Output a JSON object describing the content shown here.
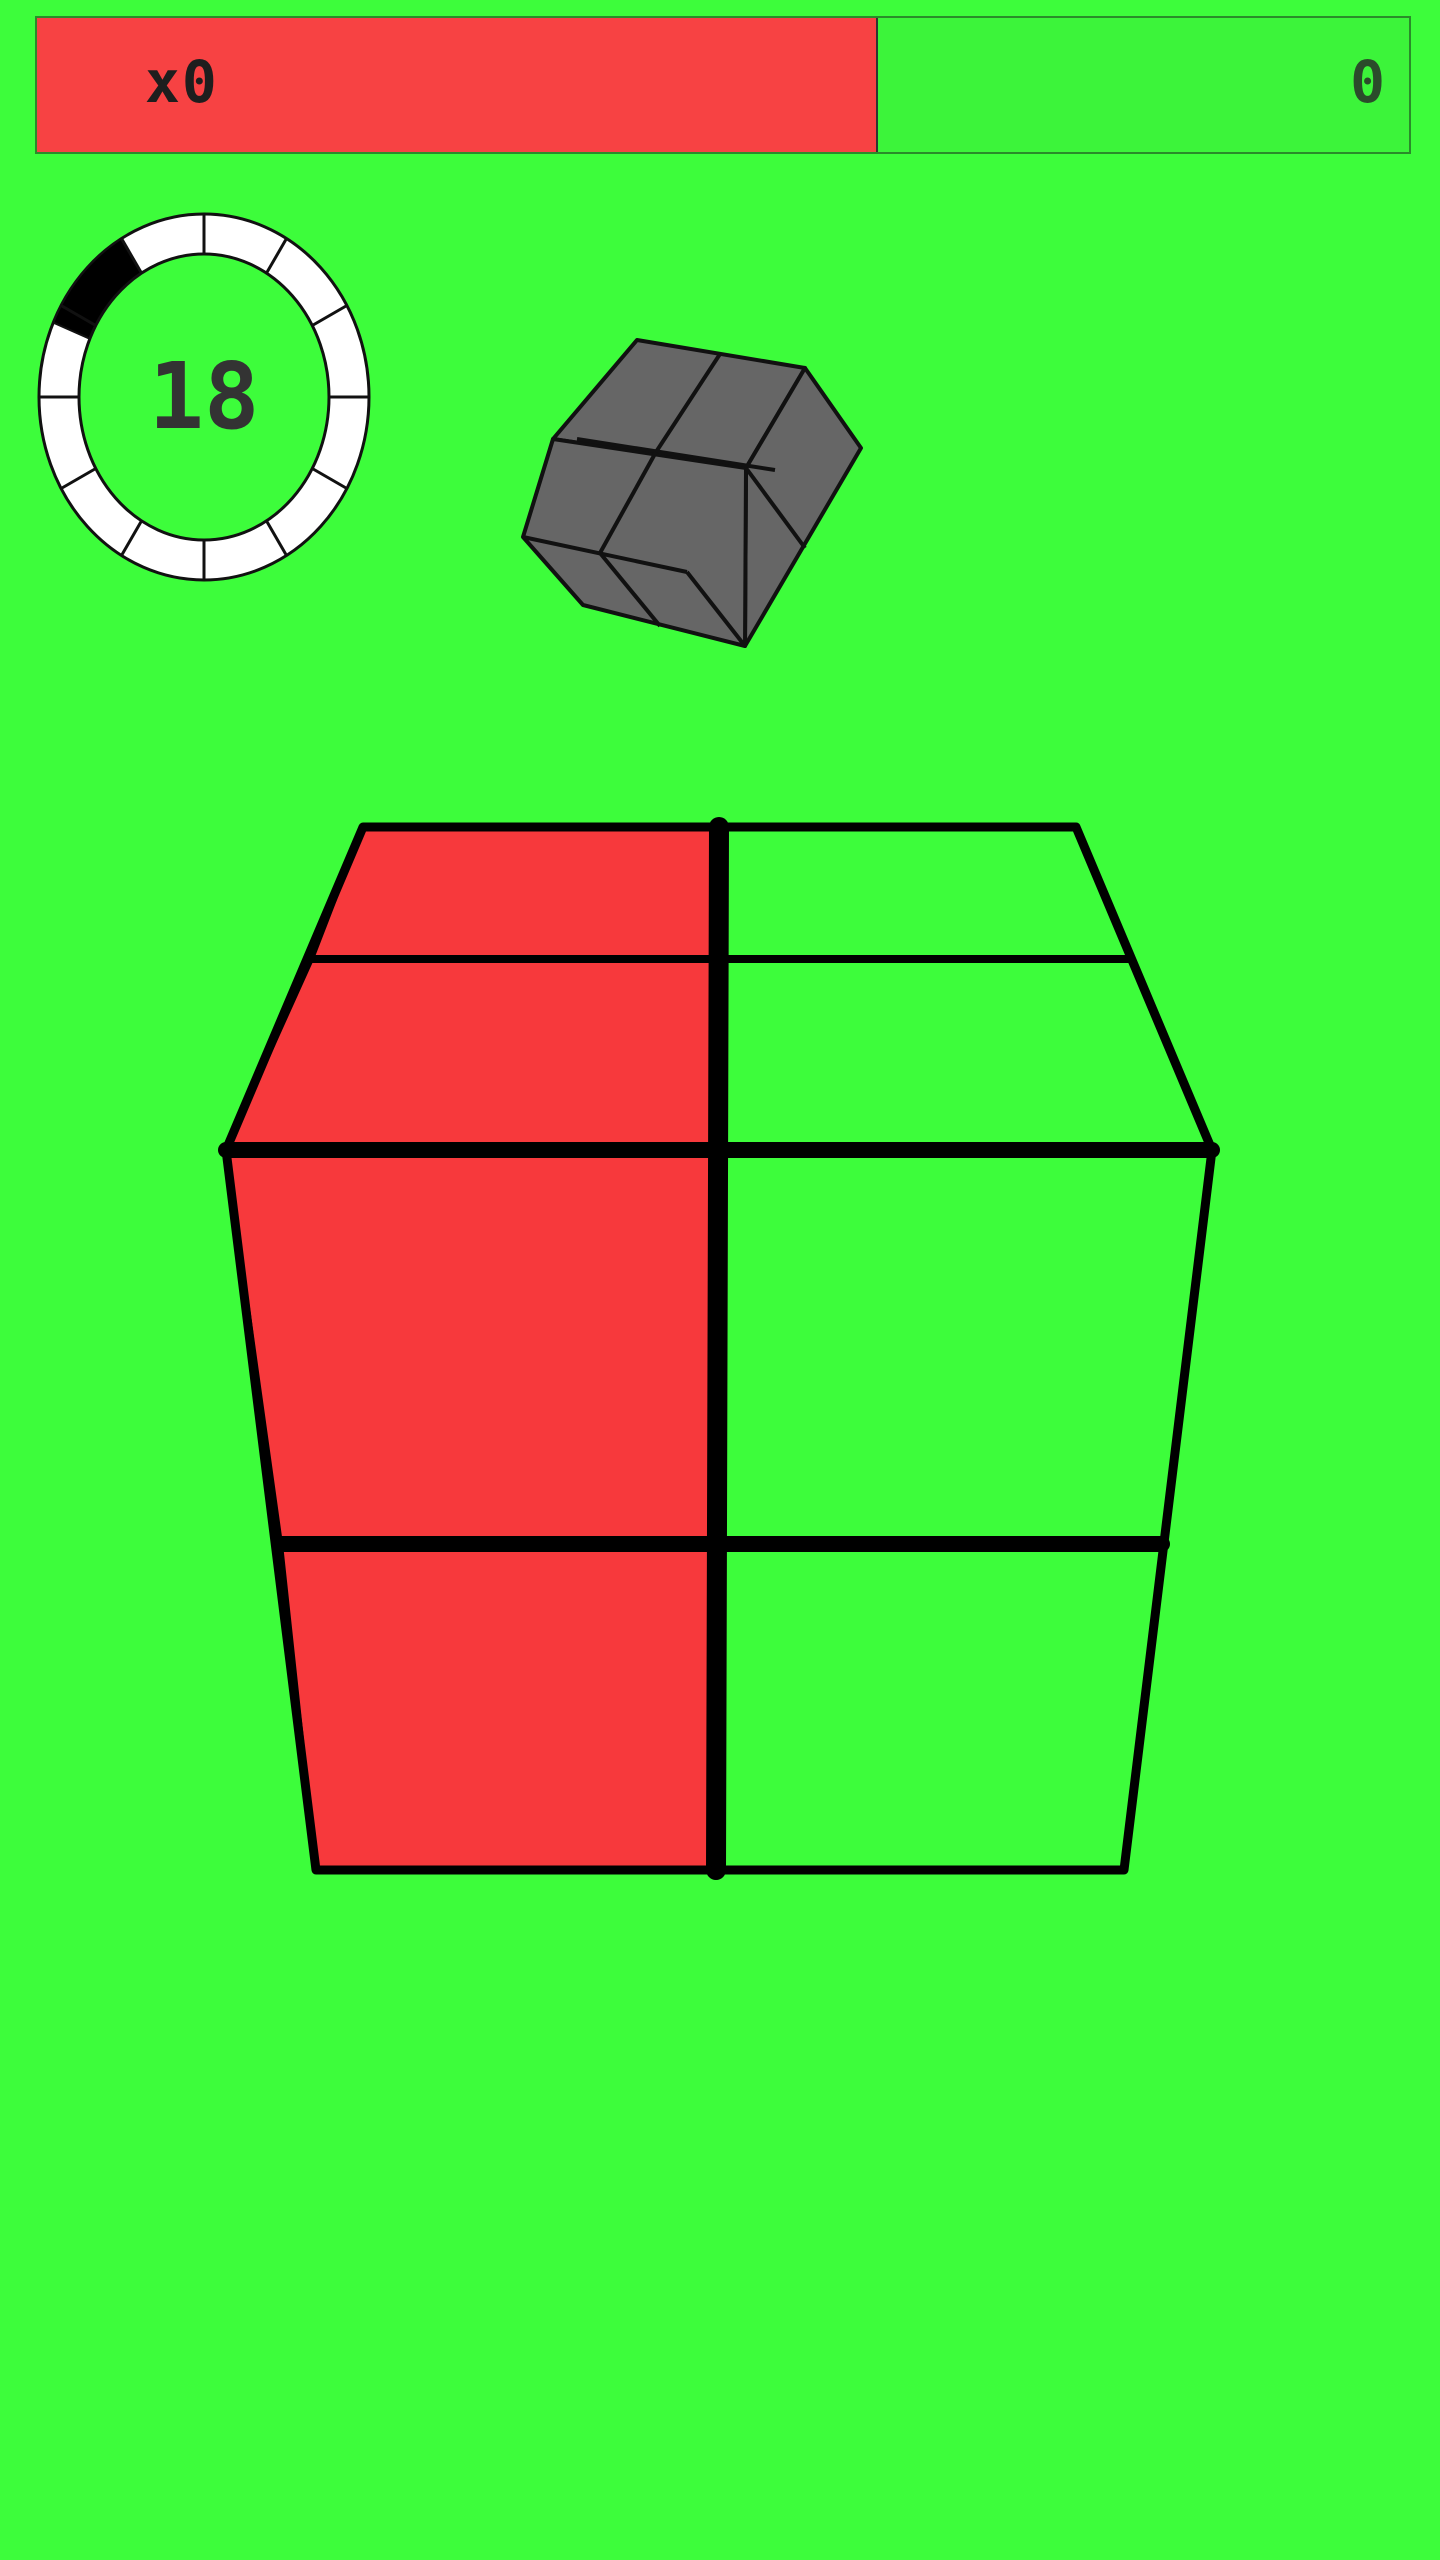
{
  "hud": {
    "multiplier": "x0",
    "score": "0",
    "timer": "18",
    "timer_progress": 0.1,
    "score_bar_split": 0.613
  },
  "colors": {
    "background": "#3dfd3b",
    "red": "#f7393c",
    "green": "#3dfd3b",
    "preview_cube": "#666666",
    "ring": "#ffffff",
    "outline": "#111111"
  },
  "main_cube": {
    "top_face": [
      "red",
      "green",
      "red",
      "green"
    ],
    "front_face": [
      "red",
      "green",
      "red",
      "green"
    ]
  },
  "preview_cube": {
    "color": "grey"
  }
}
